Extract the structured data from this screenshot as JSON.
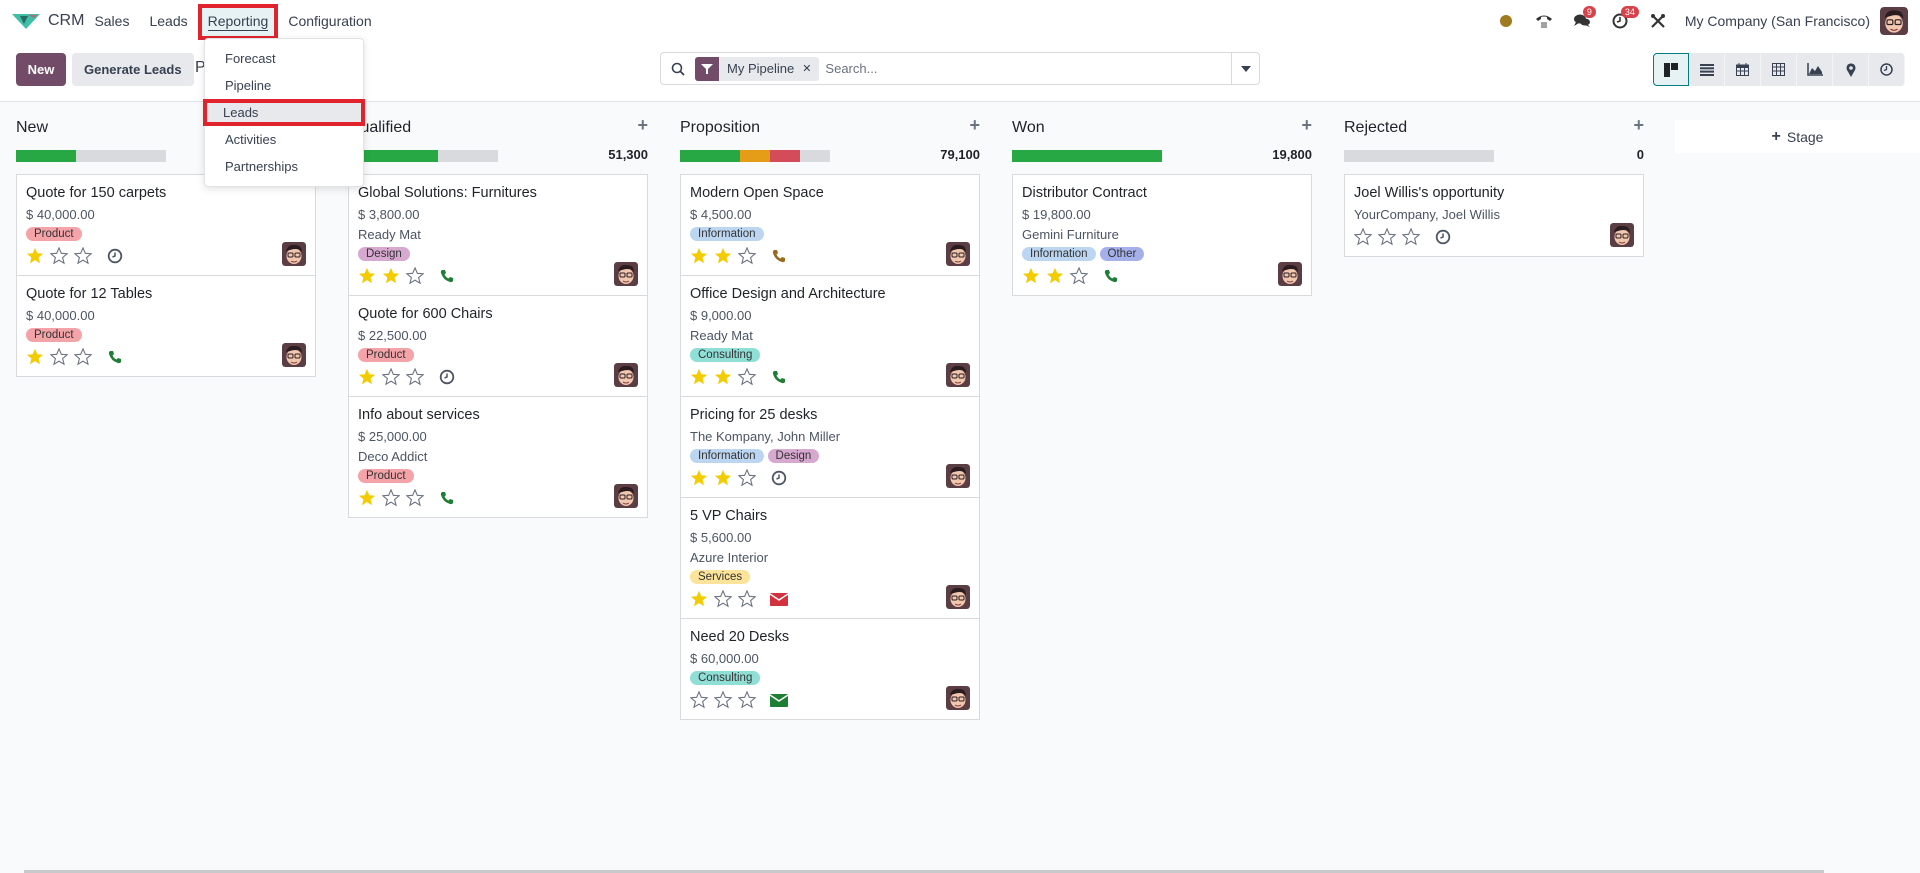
{
  "navbar": {
    "app_name": "CRM",
    "menu": [
      "Sales",
      "Leads",
      "Reporting",
      "Configuration"
    ],
    "active_menu": "Reporting",
    "messages_badge": "9",
    "activities_badge": "34",
    "company": "My Company (San Francisco)"
  },
  "reporting_menu": {
    "items": [
      "Forecast",
      "Pipeline",
      "Leads",
      "Activities",
      "Partnerships"
    ],
    "highlighted": "Leads"
  },
  "control": {
    "new_label": "New",
    "generate_label": "Generate Leads",
    "breadcrumb_partial": "P",
    "facet_label": "My Pipeline",
    "search_placeholder": "Search...",
    "views": [
      "kanban",
      "list",
      "calendar",
      "pivot",
      "graph",
      "map",
      "activity"
    ],
    "active_view": "kanban"
  },
  "add_stage_label": "Stage",
  "colors": {
    "brand": "#714b67",
    "progress_green": "#28a745",
    "progress_orange": "#e59d17",
    "progress_red": "#d44c59",
    "highlight_border": "#e0232c"
  },
  "columns": [
    {
      "title": "New",
      "total": "",
      "progress": {
        "green": 0.4,
        "orange": 0,
        "red": 0
      },
      "cards": [
        {
          "title": "Quote for 150 carpets",
          "amount": "$ 40,000.00",
          "partner": "",
          "tags": [
            {
              "label": "Product",
              "color": "#f4a3a8"
            }
          ],
          "stars": 1,
          "activity": "clock"
        },
        {
          "title": "Quote for 12 Tables",
          "amount": "$ 40,000.00",
          "partner": "",
          "tags": [
            {
              "label": "Product",
              "color": "#f4a3a8"
            }
          ],
          "stars": 1,
          "activity": "phone-green"
        }
      ]
    },
    {
      "title": "Qualified",
      "total": "51,300",
      "progress": {
        "green": 0.6,
        "orange": 0,
        "red": 0
      },
      "cards": [
        {
          "title": "Global Solutions: Furnitures",
          "amount": "$ 3,800.00",
          "partner": "Ready Mat",
          "tags": [
            {
              "label": "Design",
              "color": "#d7a8d0"
            }
          ],
          "stars": 2,
          "activity": "phone-green"
        },
        {
          "title": "Quote for 600 Chairs",
          "amount": "$ 22,500.00",
          "partner": "",
          "tags": [
            {
              "label": "Product",
              "color": "#f4a3a8"
            }
          ],
          "stars": 1,
          "activity": "clock"
        },
        {
          "title": "Info about services",
          "amount": "$ 25,000.00",
          "partner": "Deco Addict",
          "tags": [
            {
              "label": "Product",
              "color": "#f4a3a8"
            }
          ],
          "stars": 1,
          "activity": "phone-green"
        }
      ]
    },
    {
      "title": "Proposition",
      "total": "79,100",
      "progress": {
        "green": 0.4,
        "orange": 0.2,
        "red": 0.2
      },
      "cards": [
        {
          "title": "Modern Open Space",
          "amount": "$ 4,500.00",
          "partner": "",
          "tags": [
            {
              "label": "Information",
              "color": "#bcd6f2"
            }
          ],
          "stars": 2,
          "activity": "phone-orange"
        },
        {
          "title": "Office Design and Architecture",
          "amount": "$ 9,000.00",
          "partner": "Ready Mat",
          "tags": [
            {
              "label": "Consulting",
              "color": "#8fdfd6"
            }
          ],
          "stars": 2,
          "activity": "phone-green"
        },
        {
          "title": "Pricing for 25 desks",
          "amount": "",
          "partner": "The Kompany, John Miller",
          "tags": [
            {
              "label": "Information",
              "color": "#bcd6f2"
            },
            {
              "label": "Design",
              "color": "#d7a8d0"
            }
          ],
          "stars": 2,
          "activity": "clock"
        },
        {
          "title": "5 VP Chairs",
          "amount": "$ 5,600.00",
          "partner": "Azure Interior",
          "tags": [
            {
              "label": "Services",
              "color": "#fbe39a"
            }
          ],
          "stars": 1,
          "activity": "mail-red"
        },
        {
          "title": "Need 20 Desks",
          "amount": "$ 60,000.00",
          "partner": "",
          "tags": [
            {
              "label": "Consulting",
              "color": "#8fdfd6"
            }
          ],
          "stars": 0,
          "activity": "mail-green"
        }
      ]
    },
    {
      "title": "Won",
      "total": "19,800",
      "progress": {
        "green": 1.0,
        "orange": 0,
        "red": 0
      },
      "cards": [
        {
          "title": "Distributor Contract",
          "amount": "$ 19,800.00",
          "partner": "Gemini Furniture",
          "tags": [
            {
              "label": "Information",
              "color": "#bcd6f2"
            },
            {
              "label": "Other",
              "color": "#a5b0ea"
            }
          ],
          "stars": 2,
          "activity": "phone-green"
        }
      ]
    },
    {
      "title": "Rejected",
      "total": "0",
      "progress": {
        "green": 0,
        "orange": 0,
        "red": 0
      },
      "cards": [
        {
          "title": "Joel Willis's opportunity",
          "amount": "",
          "partner": "YourCompany, Joel Willis",
          "tags": [],
          "stars": 0,
          "activity": "clock"
        }
      ]
    }
  ]
}
